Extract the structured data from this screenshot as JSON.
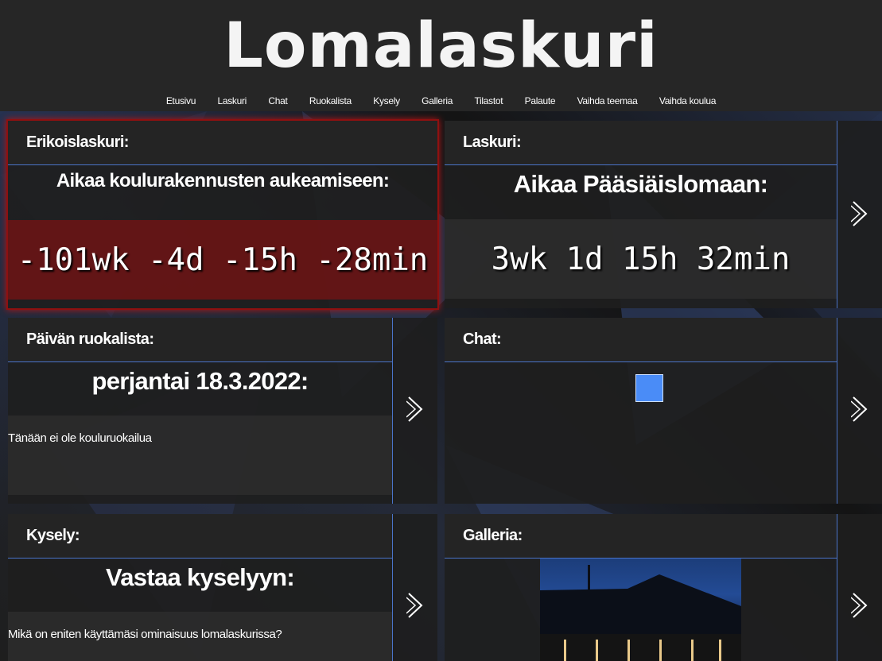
{
  "site": {
    "title": "Lomalaskuri"
  },
  "nav": [
    "Etusivu",
    "Laskuri",
    "Chat",
    "Ruokalista",
    "Kysely",
    "Galleria",
    "Tilastot",
    "Palaute",
    "Vaihda teemaa",
    "Vaihda koulua"
  ],
  "cards": {
    "erikois": {
      "heading": "Erikoislaskuri:",
      "subtitle": "Aikaa koulurakennusten aukeamiseen:",
      "value": "-101wk -4d -15h -28min"
    },
    "laskuri": {
      "heading": "Laskuri:",
      "subtitle": "Aikaa Pääsiäislomaan:",
      "value": "3wk 1d 15h 32min"
    },
    "ruokalista": {
      "heading": "Päivän ruokalista:",
      "subtitle": "perjantai 18.3.2022:",
      "text": "Tänään ei ole kouluruokailua"
    },
    "chat": {
      "heading": "Chat:",
      "loader_color": "#4a8cf7"
    },
    "kysely": {
      "heading": "Kysely:",
      "subtitle": "Vastaa kyselyyn:",
      "question": "Mikä on eniten käyttämäsi ominaisuus lomalaskurissa?"
    },
    "galleria": {
      "heading": "Galleria:"
    }
  },
  "icons": {
    "next": "chevron-right-icon"
  },
  "colors": {
    "accent": "#4a74c9",
    "highlight_red": "#6e1414"
  }
}
